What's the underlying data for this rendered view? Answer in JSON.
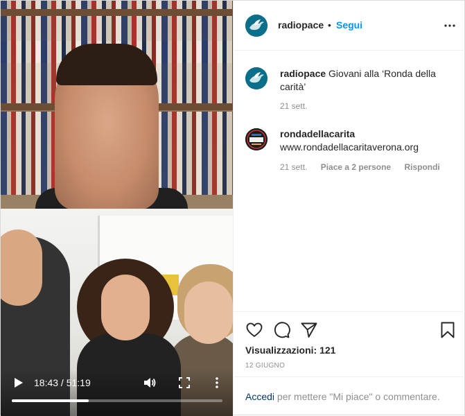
{
  "video": {
    "time": "18:43 / 51:19",
    "progress_fraction": 0.365
  },
  "header": {
    "username": "radiopace",
    "separator": "•",
    "follow_label": "Segui"
  },
  "comments": [
    {
      "username": "radiopace",
      "text": "Giovani alla ‘Ronda della carità’",
      "time": "21 sett."
    },
    {
      "username": "rondadellacarita",
      "text": "www.rondadellacaritaverona.org",
      "time": "21 sett.",
      "likes": "Piace a 2 persone",
      "reply": "Rispondi"
    }
  ],
  "actions": {
    "views": "Visualizzazioni: 121",
    "date": "12 GIUGNO"
  },
  "login": {
    "link": "Accedi",
    "rest": " per mettere \"Mi piace\" o commentare."
  },
  "colors": {
    "accent": "#0095f6",
    "muted": "#8e8e8e",
    "link": "#00376b"
  },
  "icons": [
    "play-icon",
    "volume-icon",
    "fullscreen-icon",
    "more-vertical-icon",
    "more-horizontal-icon",
    "heart-icon",
    "comment-icon",
    "share-icon",
    "bookmark-icon",
    "dove-icon"
  ]
}
